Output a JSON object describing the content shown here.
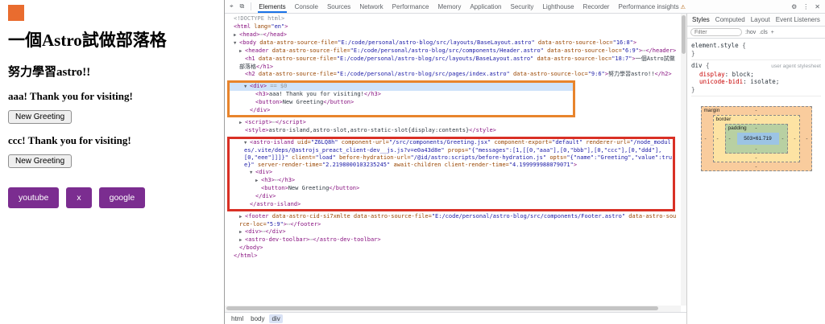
{
  "colors": {
    "accent": "#1a73e8",
    "tag": "#881280",
    "attr": "#994500",
    "val": "#1a1aa6",
    "orange": "#e8842c",
    "red": "#d93025",
    "social": "#7b2d90",
    "logo": "#e96c2f",
    "selection": "#cfe3fa"
  },
  "page": {
    "title": "一個Astro試做部落格",
    "subtitle": "努力學習astro!!",
    "greetings": [
      {
        "message": "aaa! Thank you for visiting!",
        "button": "New Greeting"
      },
      {
        "message": "ccc! Thank you for visiting!",
        "button": "New Greeting"
      }
    ],
    "social": [
      "youtube",
      "x",
      "google"
    ]
  },
  "devtools": {
    "icons": {
      "inspect": "⌖",
      "device": "⧉",
      "settings": "⚙",
      "more": "⋮",
      "close": "✕",
      "warning": "⚠"
    },
    "tabs": [
      "Elements",
      "Console",
      "Sources",
      "Network",
      "Performance",
      "Memory",
      "Application",
      "Security",
      "Lighthouse",
      "Recorder",
      "Performance insights"
    ],
    "selected_tab": "Elements",
    "warning_tab": "Performance insights",
    "breadcrumb": [
      "html",
      "body",
      "div"
    ],
    "breadcrumb_selected": 2,
    "tree": [
      {
        "lines": [
          {
            "i": 0,
            "t": [
              [
                "g",
                "<!DOCTYPE html>"
              ]
            ]
          },
          {
            "i": 0,
            "t": [
              [
                "t",
                "<html"
              ],
              [
                "a",
                " lang="
              ],
              [
                "v",
                "\"en\""
              ],
              [
                "t",
                ">"
              ]
            ]
          },
          {
            "i": 1,
            "a": "▶",
            "t": [
              [
                "t",
                "<head>"
              ],
              [
                "g",
                "⋯"
              ],
              [
                "t",
                "</head>"
              ]
            ]
          },
          {
            "i": 1,
            "a": "▼",
            "t": [
              [
                "t",
                "<body"
              ],
              [
                "a",
                " data-astro-source-file="
              ],
              [
                "v",
                "\"E:/code/personal/astro-blog/src/layouts/BaseLayout.astro\""
              ],
              [
                "a",
                " data-astro-source-loc="
              ],
              [
                "v",
                "\"16:8\""
              ],
              [
                "t",
                ">"
              ]
            ]
          },
          {
            "i": 2,
            "a": "▶",
            "t": [
              [
                "t",
                "<header"
              ],
              [
                "a",
                " data-astro-source-file="
              ],
              [
                "v",
                "\"E:/code/personal/astro-blog/src/components/Header.astro\""
              ],
              [
                "a",
                " data-astro-source-loc="
              ],
              [
                "v",
                "\"6:9\""
              ],
              [
                "t",
                ">"
              ],
              [
                "g",
                "⋯"
              ],
              [
                "t",
                "</header>"
              ]
            ]
          },
          {
            "i": 2,
            "t": [
              [
                "t",
                "<h1"
              ],
              [
                "a",
                " data-astro-source-file="
              ],
              [
                "v",
                "\"E:/code/personal/astro-blog/src/layouts/BaseLayout.astro\""
              ],
              [
                "a",
                " data-astro-source-loc="
              ],
              [
                "v",
                "\"18:7\""
              ],
              [
                "t",
                ">"
              ],
              [
                "x",
                "一個Astro試做部落格"
              ],
              [
                "t",
                "</h1>"
              ]
            ]
          },
          {
            "i": 2,
            "t": [
              [
                "t",
                "<h2"
              ],
              [
                "a",
                " data-astro-source-file="
              ],
              [
                "v",
                "\"E:/code/personal/astro-blog/src/pages/index.astro\""
              ],
              [
                "a",
                " data-astro-source-loc="
              ],
              [
                "v",
                "\"9:6\""
              ],
              [
                "t",
                ">"
              ],
              [
                "x",
                "努力學習astro!!"
              ],
              [
                "t",
                "</h2>"
              ]
            ]
          }
        ]
      },
      {
        "box": "orange",
        "lines": [
          {
            "i": 2,
            "a": "▼",
            "sel": true,
            "t": [
              [
                "t",
                "<div>"
              ],
              [
                "g",
                " == $0"
              ]
            ]
          },
          {
            "i": 3,
            "t": [
              [
                "t",
                "<h3>"
              ],
              [
                "x",
                "aaa! Thank you for visiting!"
              ],
              [
                "t",
                "</h3>"
              ]
            ]
          },
          {
            "i": 3,
            "t": [
              [
                "t",
                "<button>"
              ],
              [
                "x",
                "New Greeting"
              ],
              [
                "t",
                "</button>"
              ]
            ]
          },
          {
            "i": 2,
            "t": [
              [
                "t",
                "</div>"
              ]
            ]
          }
        ]
      },
      {
        "lines": [
          {
            "i": 2,
            "a": "▶",
            "t": [
              [
                "t",
                "<script>"
              ],
              [
                "g",
                "⋯"
              ],
              [
                "t",
                "</script>"
              ]
            ]
          },
          {
            "i": 2,
            "t": [
              [
                "t",
                "<style>"
              ],
              [
                "x",
                "astro-island,astro-slot,astro-static-slot{display:contents}"
              ],
              [
                "t",
                "</style>"
              ]
            ]
          }
        ]
      },
      {
        "box": "red",
        "lines": [
          {
            "i": 2,
            "a": "▼",
            "t": [
              [
                "t",
                "<astro-island"
              ],
              [
                "a",
                " uid="
              ],
              [
                "v",
                "\"Z6LQ8h\""
              ],
              [
                "a",
                " component-url="
              ],
              [
                "v",
                "\"/src/components/Greeting.jsx\""
              ],
              [
                "a",
                " component-export="
              ],
              [
                "v",
                "\"default\""
              ],
              [
                "a",
                " renderer-url="
              ],
              [
                "v",
                "\"/node_modules/.vite/deps/@astrojs_preact_client-dev__js.js?v=e0a43d8e\""
              ],
              [
                "a",
                " props="
              ],
              [
                "v",
                "\"{\"messages\":[1,[[0,\"aaa\"],[0,\"bbb\"],[0,\"ccc\"],[0,\"ddd\"],[0,\"eee\"]]]}\""
              ],
              [
                "a",
                " client="
              ],
              [
                "v",
                "\"load\""
              ],
              [
                "a",
                " before-hydration-url="
              ],
              [
                "v",
                "\"/@id/astro:scripts/before-hydration.js\""
              ],
              [
                "a",
                " opts="
              ],
              [
                "v",
                "\"{\"name\":\"Greeting\",\"value\":true}\""
              ],
              [
                "a",
                " server-render-time="
              ],
              [
                "v",
                "\"2.2198000103235245\""
              ],
              [
                "a",
                " await-children"
              ],
              [
                "a",
                " client-render-time="
              ],
              [
                "v",
                "\"4.199999988079071\""
              ],
              [
                "t",
                ">"
              ]
            ]
          },
          {
            "i": 3,
            "a": "▼",
            "t": [
              [
                "t",
                "<div>"
              ]
            ]
          },
          {
            "i": 4,
            "a": "▶",
            "t": [
              [
                "t",
                "<h3>"
              ],
              [
                "g",
                "⋯"
              ],
              [
                "t",
                "</h3>"
              ]
            ]
          },
          {
            "i": 4,
            "t": [
              [
                "t",
                "<button>"
              ],
              [
                "x",
                "New Greeting"
              ],
              [
                "t",
                "</button>"
              ]
            ]
          },
          {
            "i": 3,
            "t": [
              [
                "t",
                "</div>"
              ]
            ]
          },
          {
            "i": 2,
            "t": [
              [
                "t",
                "</astro-island>"
              ]
            ]
          }
        ]
      },
      {
        "lines": [
          {
            "i": 2,
            "a": "▶",
            "t": [
              [
                "t",
                "<footer"
              ],
              [
                "a",
                " data-astro-cid-si7xmlte"
              ],
              [
                "a",
                " data-astro-source-file="
              ],
              [
                "v",
                "\"E:/code/personal/astro-blog/src/components/Footer.astro\""
              ],
              [
                "a",
                " data-astro-source-loc="
              ],
              [
                "v",
                "\"5:9\""
              ],
              [
                "t",
                ">"
              ],
              [
                "g",
                "⋯"
              ],
              [
                "t",
                "</footer>"
              ]
            ]
          },
          {
            "i": 2,
            "a": "▶",
            "t": [
              [
                "t",
                "<div>"
              ],
              [
                "g",
                "⋯"
              ],
              [
                "t",
                "</div>"
              ]
            ]
          },
          {
            "i": 2,
            "a": "▶",
            "t": [
              [
                "t",
                "<astro-dev-toolbar>"
              ],
              [
                "g",
                "⋯"
              ],
              [
                "t",
                "</astro-dev-toolbar>"
              ]
            ]
          },
          {
            "i": 1,
            "t": [
              [
                "t",
                "</body>"
              ]
            ]
          },
          {
            "i": 0,
            "t": [
              [
                "t",
                "</html>"
              ]
            ]
          }
        ]
      }
    ],
    "styles_panel": {
      "tabs": [
        "Styles",
        "Computed",
        "Layout",
        "Event Listeners"
      ],
      "selected_tab": "Styles",
      "more": "»",
      "filter_placeholder": "Filter",
      "toggles": [
        ":hov",
        ".cls",
        "+"
      ],
      "element_style": {
        "selector": "element.style",
        "open": " {",
        "close": "}"
      },
      "div_rule": {
        "selector": "div",
        "open": " {",
        "close": "}",
        "origin": "user agent stylesheet",
        "props": [
          {
            "name": "display",
            "value": "block"
          },
          {
            "name": "unicode-bidi",
            "value": "isolate"
          }
        ]
      },
      "box_model": {
        "margin_label": "margin",
        "border_label": "border",
        "padding_label": "padding",
        "dash": "-",
        "content": "503×61.719"
      }
    }
  }
}
